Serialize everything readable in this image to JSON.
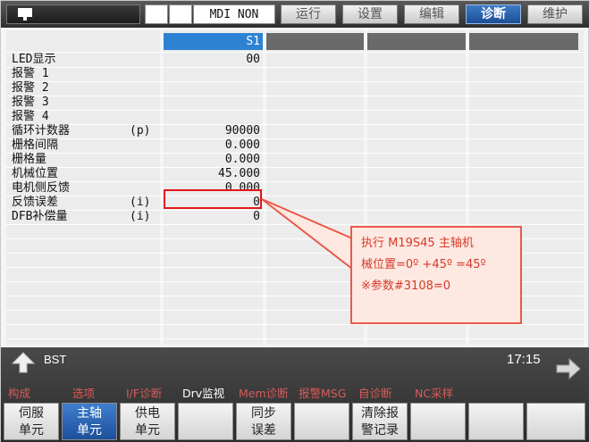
{
  "header": {
    "mode": "MDI NON",
    "tabs": [
      {
        "label": "运行"
      },
      {
        "label": "设置"
      },
      {
        "label": "编辑"
      },
      {
        "label": "诊断"
      },
      {
        "label": "维护"
      }
    ]
  },
  "table": {
    "columns": [
      "S1"
    ],
    "rows": [
      {
        "label": "LED显示",
        "unit": "",
        "value": "00"
      },
      {
        "label": "报警 1",
        "unit": "",
        "value": ""
      },
      {
        "label": "报警 2",
        "unit": "",
        "value": ""
      },
      {
        "label": "报警 3",
        "unit": "",
        "value": ""
      },
      {
        "label": "报警 4",
        "unit": "",
        "value": ""
      },
      {
        "label": "循环计数器",
        "unit": "(p)",
        "value": "90000"
      },
      {
        "label": "栅格间隔",
        "unit": "",
        "value": "0.000"
      },
      {
        "label": "栅格量",
        "unit": "",
        "value": "0.000"
      },
      {
        "label": "机械位置",
        "unit": "",
        "value": "45.000"
      },
      {
        "label": "电机侧反馈",
        "unit": "",
        "value": "0.000"
      },
      {
        "label": "反馈误差",
        "unit": "(i)",
        "value": "0"
      },
      {
        "label": "DFB补偿量",
        "unit": "(i)",
        "value": "0"
      }
    ]
  },
  "annotation": {
    "lines": [
      "执行 M19S45 主轴机",
      "械位置=0º +45º =45º",
      "※参数#3108=0"
    ],
    "color": "#e4161b"
  },
  "footer": {
    "bst": "BST",
    "time": "17:15",
    "menu": [
      {
        "label": "构成",
        "color": "#d85a5a"
      },
      {
        "label": "选项",
        "color": "#d85a5a"
      },
      {
        "label": "I/F诊断",
        "color": "#d85a5a"
      },
      {
        "label": "Drv监视",
        "color": "#ffffff"
      },
      {
        "label": "Mem诊断",
        "color": "#d85a5a"
      },
      {
        "label": "报警MSG",
        "color": "#d85a5a"
      },
      {
        "label": "自诊断",
        "color": "#d85a5a"
      },
      {
        "label": "NC采样",
        "color": "#d85a5a"
      }
    ],
    "softkeys": [
      {
        "line1": "伺服",
        "line2": "单元"
      },
      {
        "line1": "主轴",
        "line2": "单元"
      },
      {
        "line1": "供电",
        "line2": "单元"
      },
      {
        "line1": "",
        "line2": ""
      },
      {
        "line1": "同步",
        "line2": "误差"
      },
      {
        "line1": "",
        "line2": ""
      },
      {
        "line1": "清除报",
        "line2": "警记录"
      },
      {
        "line1": "",
        "line2": ""
      },
      {
        "line1": "",
        "line2": ""
      },
      {
        "line1": "",
        "line2": ""
      }
    ]
  },
  "colors": {
    "accent": "#2d82d4",
    "active_tab": "#1c4e96"
  }
}
